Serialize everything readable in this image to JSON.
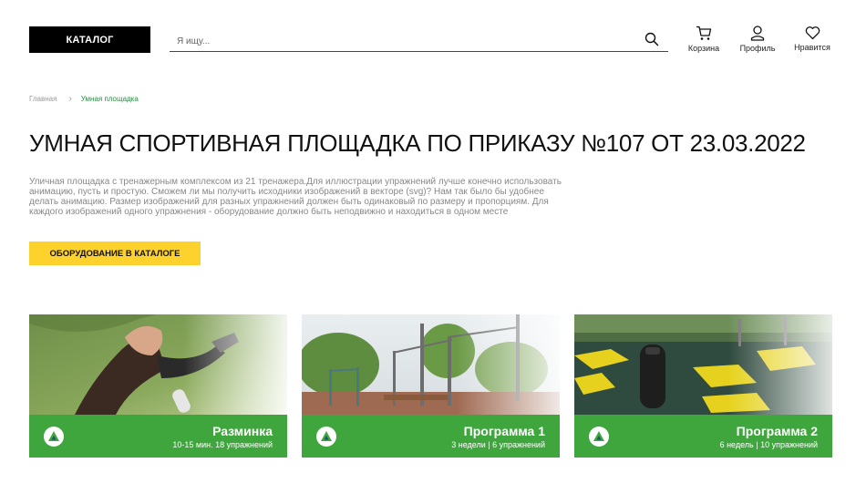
{
  "header": {
    "catalog_label": "КАТАЛОГ",
    "search_placeholder": "Я ищу...",
    "cart_label": "Корзина",
    "profile_label": "Профиль",
    "favorites_label": "Нравится"
  },
  "breadcrumb": {
    "home": "Главная",
    "current": "Умная площадка"
  },
  "page": {
    "title": "УМНАЯ СПОРТИВНАЯ ПЛОЩАДКА ПО ПРИКАЗУ №107 ОТ 23.03.2022",
    "description": "Уличная площадка с тренажерным комплексом из 21 тренажера.Для иллюстрации упражнений лучше конечно использовать анимацию, пусть и простую. Сможем ли мы получить исходники изображений в векторе (svg)? Нам так было бы удобнее делать анимацию. Размер изображений для разных упражнений должен быть одинаковый по размеру и пропорциям. Для каждого изображений одного упражнения - оборудование должно быть неподвижно и находиться в одном месте",
    "cta_label": "ОБОРУДОВАНИЕ В КАТАЛОГЕ"
  },
  "cards": [
    {
      "title": "Разминка",
      "subtitle": "10-15 мин. 18 упражнений",
      "icon": "logo-icon"
    },
    {
      "title": "Программа 1",
      "subtitle": "3 недели | 6 упражнений",
      "icon": "logo-icon"
    },
    {
      "title": "Программа 2",
      "subtitle": "6 недель | 10 упражнений",
      "icon": "logo-icon"
    }
  ],
  "colors": {
    "accent_yellow": "#fdd22d",
    "card_green": "#3ea63c",
    "breadcrumb_green": "#2e8a45",
    "catalog_black": "#000000"
  }
}
